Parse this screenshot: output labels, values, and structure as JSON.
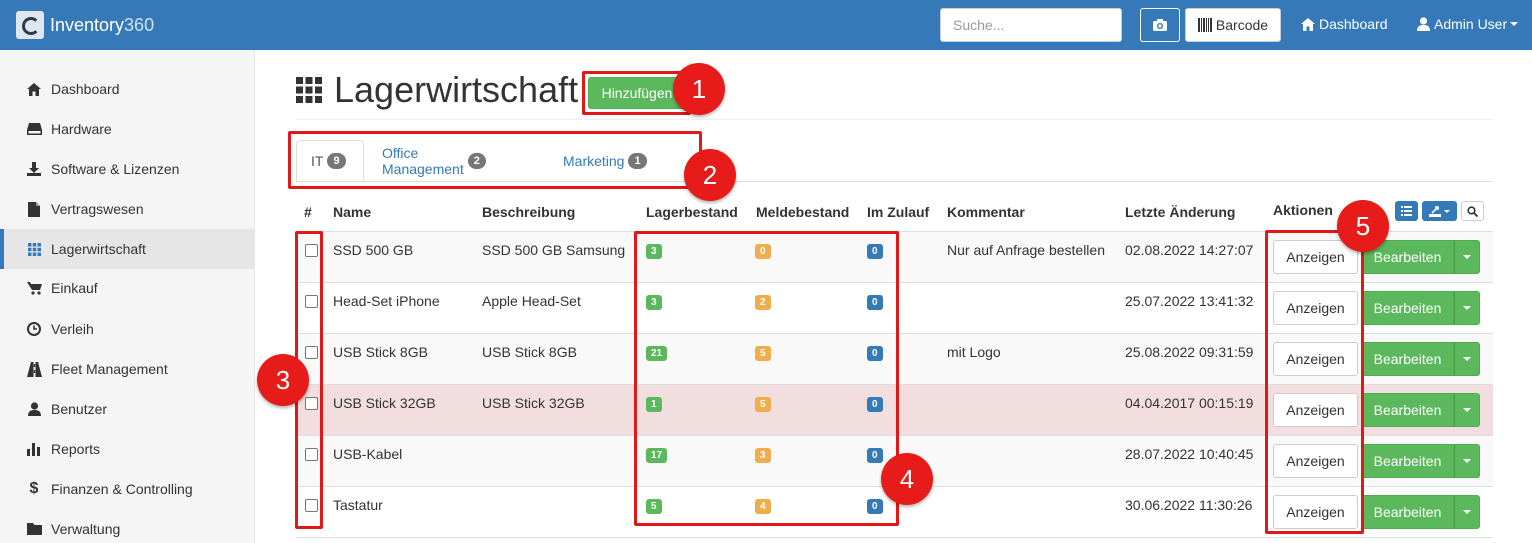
{
  "navbar": {
    "brand_main": "Inventory",
    "brand_num": "360",
    "search_placeholder": "Suche...",
    "barcode_label": "Barcode",
    "dashboard_label": "Dashboard",
    "user_label": "Admin User"
  },
  "sidebar": {
    "items": [
      {
        "label": "Dashboard",
        "icon": "home-icon"
      },
      {
        "label": "Hardware",
        "icon": "hdd-icon"
      },
      {
        "label": "Software & Lizenzen",
        "icon": "download-icon"
      },
      {
        "label": "Vertragswesen",
        "icon": "file-icon"
      },
      {
        "label": "Lagerwirtschaft",
        "icon": "grid-icon",
        "active": true
      },
      {
        "label": "Einkauf",
        "icon": "cart-icon"
      },
      {
        "label": "Verleih",
        "icon": "clock-icon"
      },
      {
        "label": "Fleet Management",
        "icon": "road-icon"
      },
      {
        "label": "Benutzer",
        "icon": "user-icon"
      },
      {
        "label": "Reports",
        "icon": "bar-chart-icon"
      },
      {
        "label": "Finanzen & Controlling",
        "icon": "dollar-icon"
      },
      {
        "label": "Verwaltung",
        "icon": "folder-icon"
      }
    ]
  },
  "page": {
    "title": "Lagerwirtschaft",
    "add_label": "Hinzufügen"
  },
  "tabs": [
    {
      "label": "IT",
      "count": "9"
    },
    {
      "label": "Office Management",
      "count": "2"
    },
    {
      "label": "Marketing",
      "count": "1"
    }
  ],
  "table": {
    "headers": {
      "num": "#",
      "name": "Name",
      "desc": "Beschreibung",
      "stock": "Lagerbestand",
      "reorder": "Meldebestand",
      "incoming": "Im Zulauf",
      "comment": "Kommentar",
      "changed": "Letzte Änderung",
      "actions": "Aktionen"
    },
    "view_label": "Anzeigen",
    "edit_label": "Bearbeiten",
    "rows": [
      {
        "name": "SSD 500 GB",
        "desc": "SSD 500 GB Samsung",
        "stock": "3",
        "reorder": "0",
        "incoming": "0",
        "comment": "Nur auf Anfrage bestellen",
        "changed": "02.08.2022 14:27:07"
      },
      {
        "name": "Head-Set iPhone",
        "desc": "Apple Head-Set",
        "stock": "3",
        "reorder": "2",
        "incoming": "0",
        "comment": "",
        "changed": "25.07.2022 13:41:32"
      },
      {
        "name": "USB Stick 8GB",
        "desc": "USB Stick 8GB",
        "stock": "21",
        "reorder": "5",
        "incoming": "0",
        "comment": "mit Logo",
        "changed": "25.08.2022 09:31:59"
      },
      {
        "name": "USB Stick 32GB",
        "desc": "USB Stick 32GB",
        "stock": "1",
        "reorder": "5",
        "incoming": "0",
        "comment": "",
        "changed": "04.04.2017 00:15:19"
      },
      {
        "name": "USB-Kabel",
        "desc": "",
        "stock": "17",
        "reorder": "3",
        "incoming": "0",
        "comment": "",
        "changed": "28.07.2022 10:40:45"
      },
      {
        "name": "Tastatur",
        "desc": "",
        "stock": "5",
        "reorder": "4",
        "incoming": "0",
        "comment": "",
        "changed": "30.06.2022 11:30:26"
      }
    ]
  },
  "annotations": [
    "1",
    "2",
    "3",
    "4",
    "5"
  ],
  "colors": {
    "navbar": "#3579b9",
    "success": "#5cb85c",
    "warning": "#f0ad4e",
    "primary": "#337ab7",
    "danger_row": "#f2dede",
    "annotation": "#e01818"
  }
}
